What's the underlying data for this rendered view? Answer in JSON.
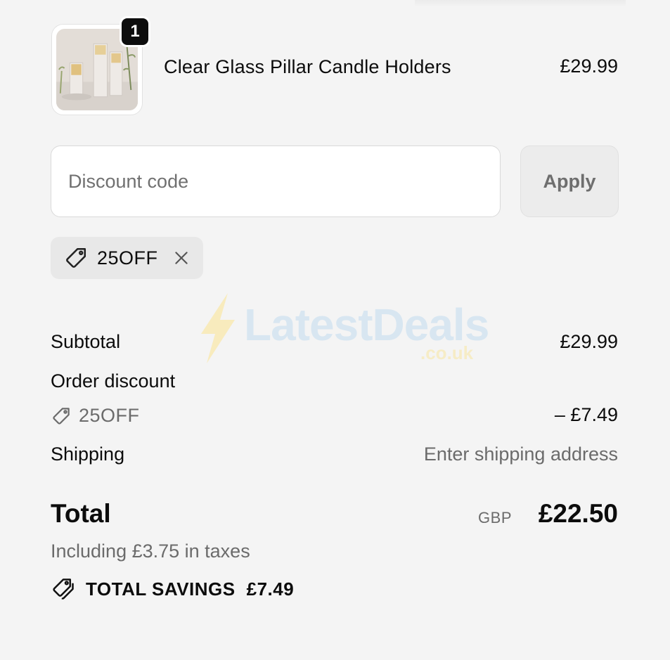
{
  "product": {
    "quantity": "1",
    "name": "Clear Glass Pillar Candle Holders",
    "price": "£29.99",
    "thumbnail": "candle-holders-photo"
  },
  "discount": {
    "placeholder": "Discount code",
    "apply_label": "Apply",
    "applied_code": "25OFF"
  },
  "watermark": {
    "brand": "LatestDeals",
    "domain": ".co.uk"
  },
  "summary": {
    "subtotal_label": "Subtotal",
    "subtotal_value": "£29.99",
    "order_discount_label": "Order discount",
    "discount_code": "25OFF",
    "discount_value": "– £7.49",
    "shipping_label": "Shipping",
    "shipping_value": "Enter shipping address",
    "total_label": "Total",
    "currency": "GBP",
    "total_value": "£22.50",
    "tax_note": "Including £3.75 in taxes",
    "savings_label": "TOTAL SAVINGS",
    "savings_value": "£7.49"
  },
  "colors": {
    "background": "#f4f4f4",
    "text": "#0c0c0c",
    "muted": "#6b6b6b",
    "chip": "#e8e8e8",
    "badge": "#0d0d0d"
  }
}
